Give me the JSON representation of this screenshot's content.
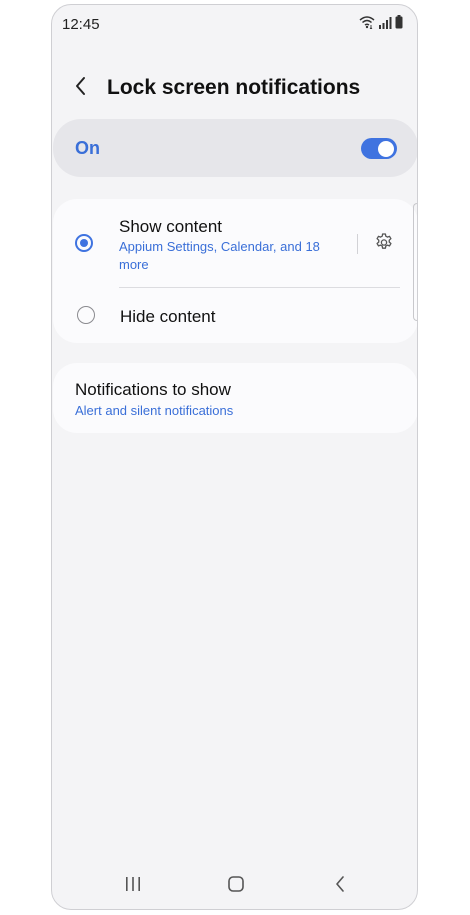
{
  "status_bar": {
    "time": "12:45",
    "icons": [
      "wifi-icon",
      "signal-icon",
      "battery-icon"
    ]
  },
  "header": {
    "back_icon": "chevron-left-icon",
    "title": "Lock screen notifications"
  },
  "master_switch": {
    "label": "On",
    "enabled": true
  },
  "options": [
    {
      "title": "Show content",
      "subtitle": "Appium Settings, Calendar, and 18 more",
      "selected": true,
      "settings_icon": "gear-icon"
    },
    {
      "title": "Hide content",
      "selected": false
    }
  ],
  "notifications_to_show": {
    "title": "Notifications to show",
    "value": "Alert and silent notifications"
  },
  "nav_bar": {
    "buttons": [
      "recents-icon",
      "home-icon",
      "back-icon"
    ]
  },
  "colors": {
    "accent": "#3f73e0",
    "background": "#f4f4f6",
    "card": "#fbfbfd",
    "master_switch_bg": "#e6e6ea"
  }
}
